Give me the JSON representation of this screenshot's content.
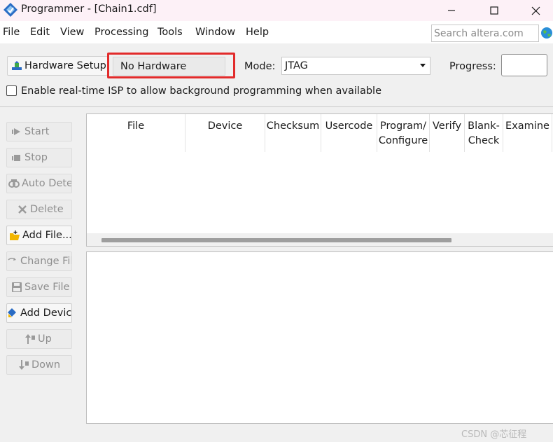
{
  "window": {
    "title": "Programmer - [Chain1.cdf]"
  },
  "menubar": {
    "items": [
      "File",
      "Edit",
      "View",
      "Processing",
      "Tools",
      "Window",
      "Help"
    ],
    "search_placeholder": "Search altera.com"
  },
  "toolbar": {
    "hardware_setup_label": "Hardware Setup...",
    "hardware_value": "No Hardware",
    "mode_label": "Mode:",
    "mode_value": "JTAG",
    "progress_label": "Progress:",
    "isp_checkbox_label": "Enable real-time ISP to allow background programming when available",
    "isp_checked": false
  },
  "sidebar": {
    "buttons": [
      {
        "label": "Start",
        "enabled": false,
        "icon": "play-icon"
      },
      {
        "label": "Stop",
        "enabled": false,
        "icon": "stop-icon"
      },
      {
        "label": "Auto Detect",
        "enabled": false,
        "icon": "auto-detect-icon"
      },
      {
        "label": "Delete",
        "enabled": false,
        "icon": "delete-icon"
      },
      {
        "label": "Add File...",
        "enabled": true,
        "icon": "add-file-icon"
      },
      {
        "label": "Change File...",
        "enabled": false,
        "icon": "change-file-icon"
      },
      {
        "label": "Save File",
        "enabled": false,
        "icon": "save-icon"
      },
      {
        "label": "Add Device...",
        "enabled": true,
        "icon": "add-device-icon"
      },
      {
        "label": "Up",
        "enabled": false,
        "icon": "up-icon"
      },
      {
        "label": "Down",
        "enabled": false,
        "icon": "down-icon"
      }
    ]
  },
  "table": {
    "columns": [
      {
        "label": "File"
      },
      {
        "label": "Device"
      },
      {
        "label": "Checksum"
      },
      {
        "label": "Usercode"
      },
      {
        "label": "Program/ Configure"
      },
      {
        "label": "Verify"
      },
      {
        "label": "Blank- Check"
      },
      {
        "label": "Examine"
      }
    ],
    "rows": []
  },
  "watermark": "CSDN @芯征程",
  "colors": {
    "titlebar_bg": "#fdf1f7",
    "highlight_border": "#e22b2b",
    "disabled_text": "#8e8e8e"
  }
}
